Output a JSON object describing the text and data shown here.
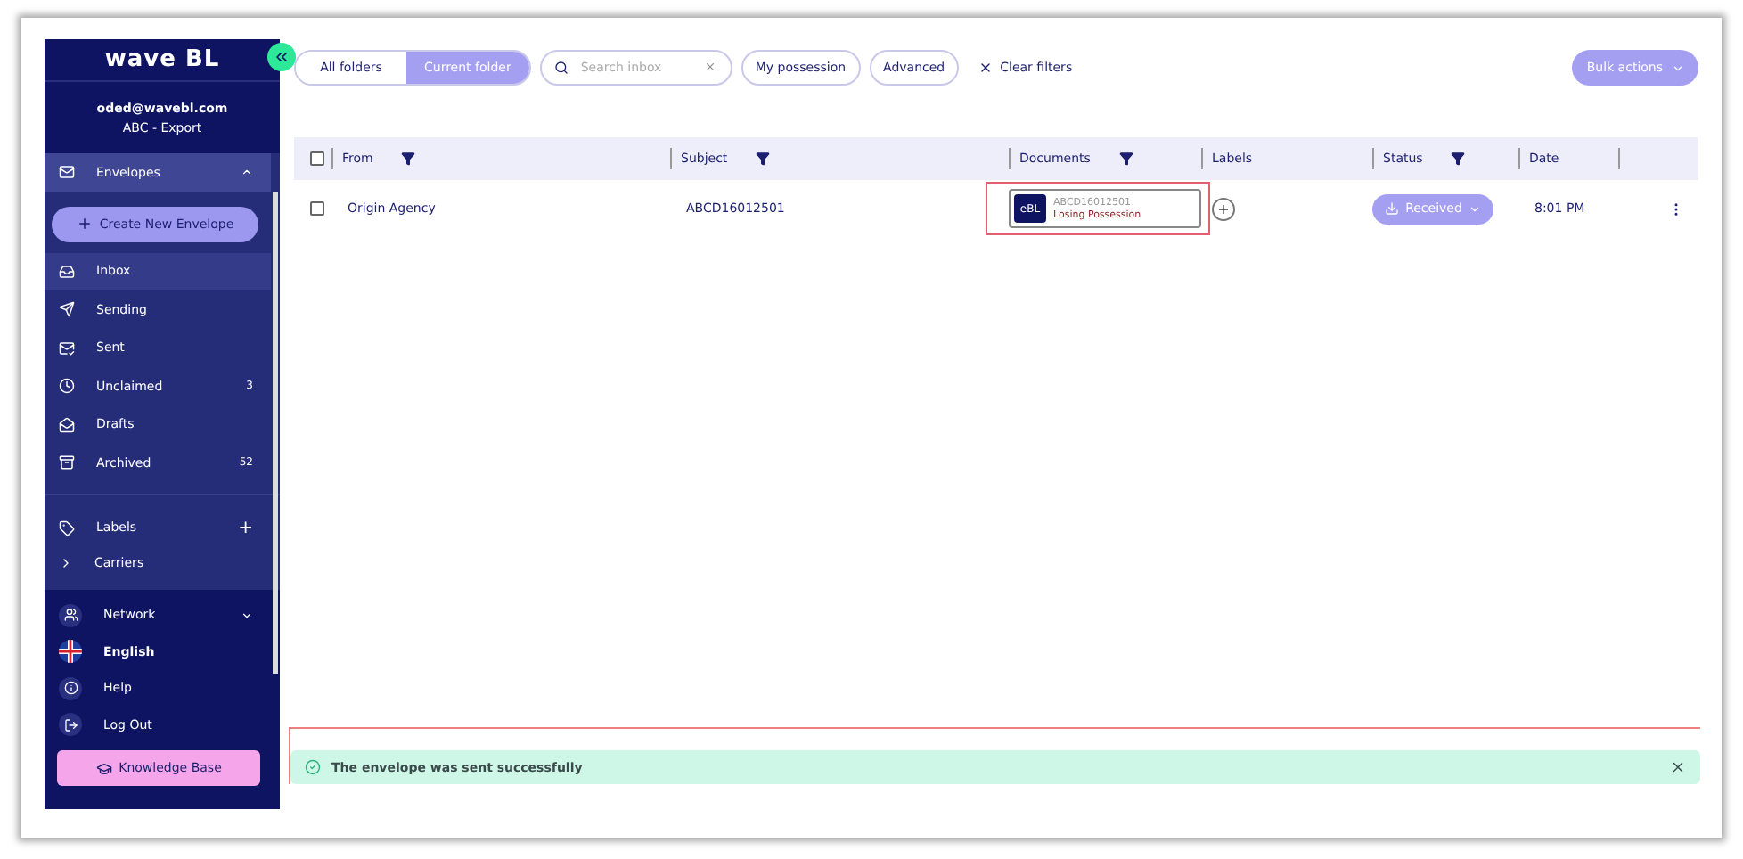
{
  "sidebar": {
    "logo": "wave BL",
    "account": {
      "email": "oded@wavebl.com",
      "company": "ABC - Export"
    },
    "envelopes": {
      "label": "Envelopes",
      "expanded": true
    },
    "create_button": "Create New Envelope",
    "folders": [
      {
        "label": "Inbox",
        "kind": "inbox",
        "selected": true
      },
      {
        "label": "Sending",
        "kind": "sending",
        "selected": false
      },
      {
        "label": "Sent",
        "kind": "sent",
        "selected": false
      },
      {
        "label": "Unclaimed",
        "kind": "unclaimed",
        "count": "3",
        "selected": false
      },
      {
        "label": "Drafts",
        "kind": "drafts",
        "selected": false
      },
      {
        "label": "Archived",
        "kind": "archive",
        "count": "52",
        "selected": false
      }
    ],
    "labels": {
      "label": "Labels",
      "add": "+"
    },
    "label_items": [
      {
        "label": "Carriers",
        "expanded": false
      }
    ],
    "bottom": [
      {
        "label": "Network",
        "kind": "network",
        "caret": true
      },
      {
        "label": "English",
        "kind": "language",
        "caret": false
      },
      {
        "label": "Help",
        "kind": "help",
        "caret": false
      },
      {
        "label": "Log Out",
        "kind": "logout",
        "caret": false
      }
    ],
    "knowledge_base": "Knowledge Base"
  },
  "toolbar": {
    "scope": [
      {
        "label": "All folders",
        "selected": false
      },
      {
        "label": "Current folder",
        "selected": true
      }
    ],
    "search": {
      "placeholder": "Search inbox"
    },
    "filters": [
      "My possession",
      "Advanced"
    ],
    "clear": "Clear filters",
    "bulk": "Bulk actions"
  },
  "table": {
    "all_checked": false,
    "columns": [
      {
        "label": "From",
        "filter": true
      },
      {
        "label": "Subject",
        "filter": true
      },
      {
        "label": "Documents",
        "filter": true
      },
      {
        "label": "Labels",
        "filter": false
      },
      {
        "label": "Status",
        "filter": true
      },
      {
        "label": "Date",
        "filter": false
      }
    ],
    "rows": [
      {
        "checked": false,
        "from": "Origin Agency",
        "subject": "ABCD16012501",
        "document": {
          "badge": "eBL",
          "number": "ABCD16012501",
          "state": "Losing Possession",
          "highlighted": true
        },
        "labels_add": "+",
        "status": "Received",
        "date": "8:01 PM"
      }
    ]
  },
  "toast": {
    "message": "The envelope was sent successfully",
    "highlighted": true
  }
}
